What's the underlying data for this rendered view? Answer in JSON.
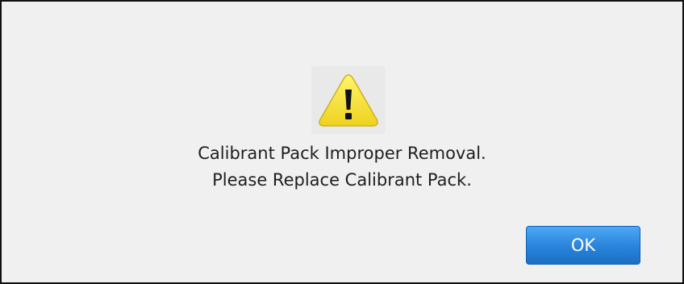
{
  "dialog": {
    "icon": "warning-icon",
    "message_lines": [
      "Calibrant Pack Improper Removal.",
      "Please Replace Calibrant Pack."
    ],
    "ok_label": "OK"
  },
  "colors": {
    "background": "#f0f0f0",
    "border": "#111111",
    "warning_fill": "#f7e842",
    "button_blue": "#2b86dc",
    "button_text": "#ffffff"
  }
}
